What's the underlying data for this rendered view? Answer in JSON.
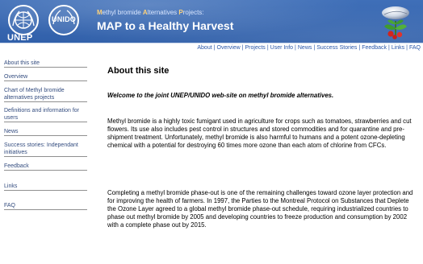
{
  "header": {
    "unep_label": "UNEP",
    "unido_label": "UNIDO",
    "tagline_parts": [
      {
        "text": "M",
        "highlight": true
      },
      {
        "text": "ethyl bromide ",
        "highlight": false
      },
      {
        "text": "A",
        "highlight": true
      },
      {
        "text": "lternatives ",
        "highlight": false
      },
      {
        "text": "P",
        "highlight": true
      },
      {
        "text": "rojects:",
        "highlight": false
      }
    ],
    "site_title": "MAP to a Healthy Harvest"
  },
  "topnav": {
    "links": [
      "About",
      "Overview",
      "Projects",
      "User Info",
      "News",
      "Success Stories",
      "Feedback",
      "Links",
      "FAQ"
    ],
    "separator": "|"
  },
  "sidebar": {
    "items": [
      {
        "label": "About this site"
      },
      {
        "label": "Overview"
      },
      {
        "label": "Chart of Methyl bromide alternatives projects"
      },
      {
        "label": "Definitions and information for users"
      },
      {
        "label": "News"
      },
      {
        "label": "Success stories: Independant initiatives"
      },
      {
        "label": "Feedback"
      },
      {
        "label": "Links"
      },
      {
        "label": "FAQ"
      }
    ]
  },
  "main": {
    "title": "About this site",
    "welcome": "Welcome to the joint UNEP/UNIDO web-site on methyl bromide alternatives.",
    "paragraphs": [
      "Methyl bromide is a highly toxic fumigant used in agriculture for crops such as tomatoes, strawberries and cut flowers. Its use also includes pest control in structures and stored commodities and for quarantine and pre-shipment treatment. Unfortunately, methyl bromide is also harmful to humans and a potent ozone-depleting chemical with a potential for destroying 60 times more ozone than each atom of chlorine from CFCs.",
      "Completing a methyl bromide phase-out is one of the remaining challenges toward ozone layer protection and for improving the health of farmers. In 1997, the Parties to the Montreal Protocol on Substances that Deplete the Ozone Layer agreed to a global methyl bromide phase-out schedule, requiring industrialized countries to phase out methyl bromide by 2005 and developing countries to freeze production and consumption by 2002 with a complete phase out by 2015."
    ]
  },
  "colors": {
    "header_blue": "#2f5ea8",
    "nav_link": "#2a57a8",
    "tagline_highlight": "#ffd37a"
  },
  "icons": {
    "unep": "unep-emblem-icon",
    "unido": "unido-emblem-icon",
    "globe": "ozone-globe-icon"
  }
}
